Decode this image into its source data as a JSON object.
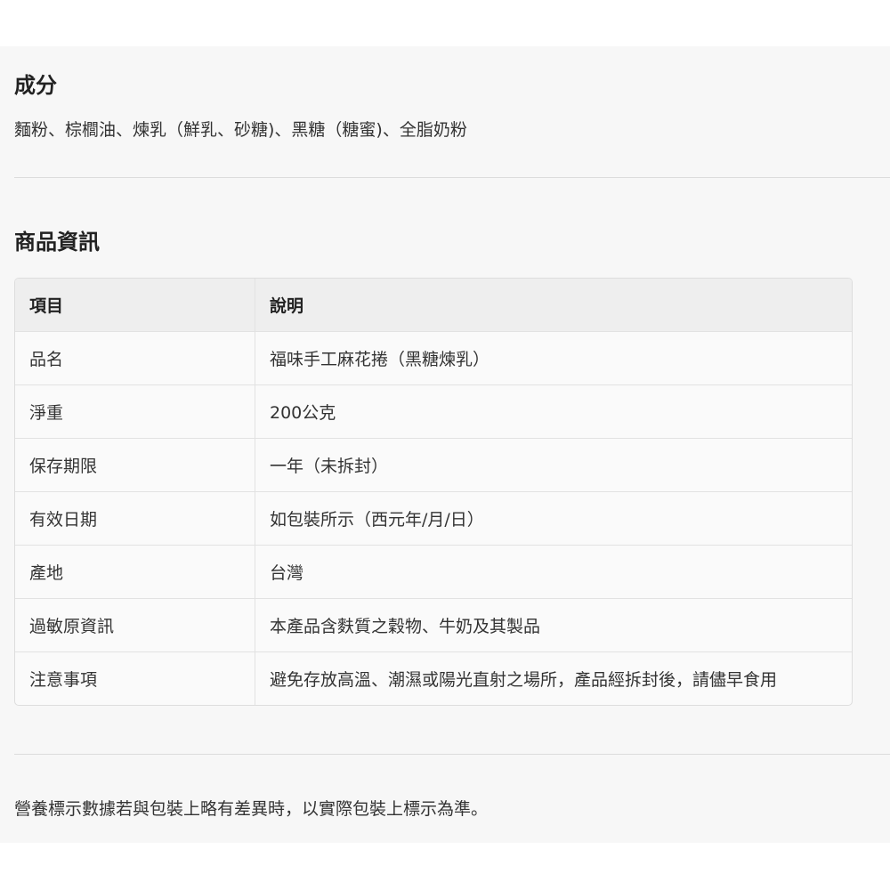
{
  "ingredients": {
    "title": "成分",
    "text": "麵粉、棕櫚油、煉乳（鮮乳、砂糖)、黑糖（糖蜜)、全脂奶粉"
  },
  "product_info": {
    "title": "商品資訊",
    "header": {
      "item": "項目",
      "desc": "說明"
    },
    "rows": [
      {
        "item": "品名",
        "desc": "福味手工麻花捲（黑糖煉乳）"
      },
      {
        "item": "淨重",
        "desc": "200公克"
      },
      {
        "item": "保存期限",
        "desc": "一年（未拆封）"
      },
      {
        "item": "有效日期",
        "desc": "如包裝所示（西元年/月/日）"
      },
      {
        "item": "產地",
        "desc": "台灣"
      },
      {
        "item": "過敏原資訊",
        "desc": "本產品含麩質之穀物、牛奶及其製品"
      },
      {
        "item": "注意事項",
        "desc": "避免存放高溫、潮濕或陽光直射之場所，產品經拆封後，請儘早食用"
      }
    ]
  },
  "note": {
    "text": "營養標示數據若與包裝上略有差異時，以實際包裝上標示為準。"
  }
}
